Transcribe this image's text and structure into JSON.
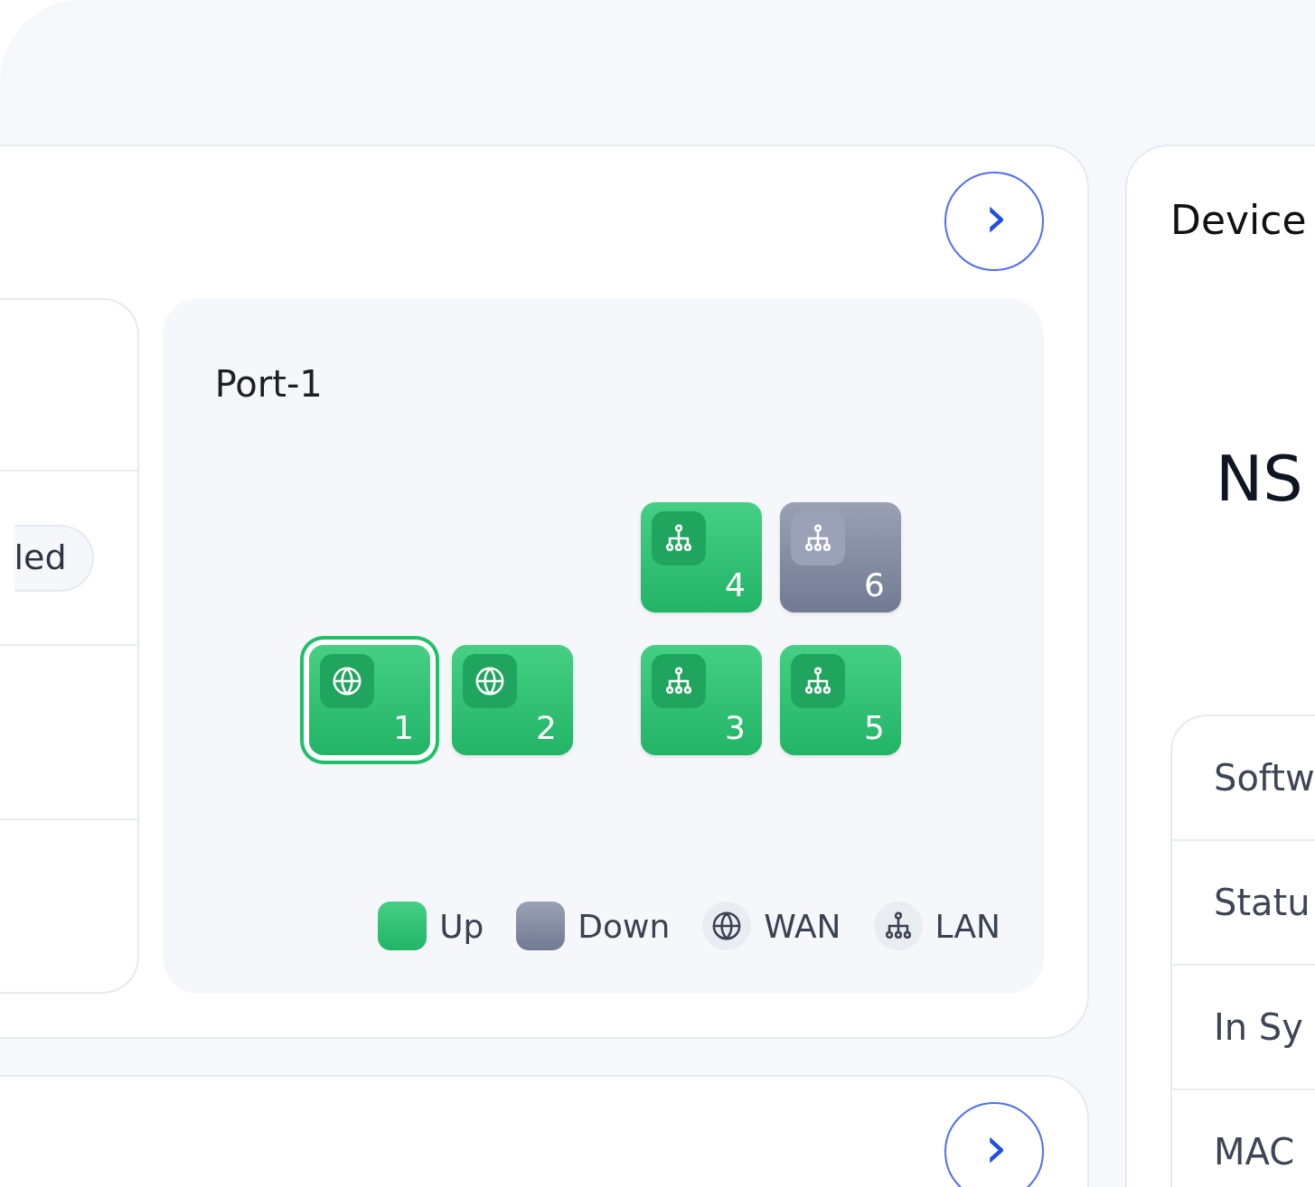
{
  "main_card": {
    "next_button": {
      "label": "›"
    },
    "settings_panel": {
      "status_pill": "led"
    },
    "port_panel": {
      "title": "Port-1",
      "port_rows": [
        {
          "ports": [
            {
              "number": "4",
              "kind": "lan",
              "up": true,
              "selected": false
            },
            {
              "number": "6",
              "kind": "lan",
              "up": false,
              "selected": false
            }
          ]
        },
        {
          "ports": [
            {
              "number": "1",
              "kind": "wan",
              "up": true,
              "selected": true
            },
            {
              "number": "2",
              "kind": "wan",
              "up": true,
              "selected": false
            },
            {
              "number": "3",
              "kind": "lan",
              "up": true,
              "selected": false
            },
            {
              "number": "5",
              "kind": "lan",
              "up": true,
              "selected": false
            }
          ]
        }
      ],
      "legend": [
        {
          "kind": "up",
          "label": "Up"
        },
        {
          "kind": "down",
          "label": "Down"
        },
        {
          "kind": "wan",
          "label": "WAN"
        },
        {
          "kind": "lan",
          "label": "LAN"
        }
      ]
    }
  },
  "second_card": {
    "next_button": {
      "label": "›"
    }
  },
  "device_card": {
    "title": "Device",
    "model": "NS",
    "info_rows": [
      "Softw",
      "Statu",
      "In Sy",
      "MAC"
    ]
  }
}
